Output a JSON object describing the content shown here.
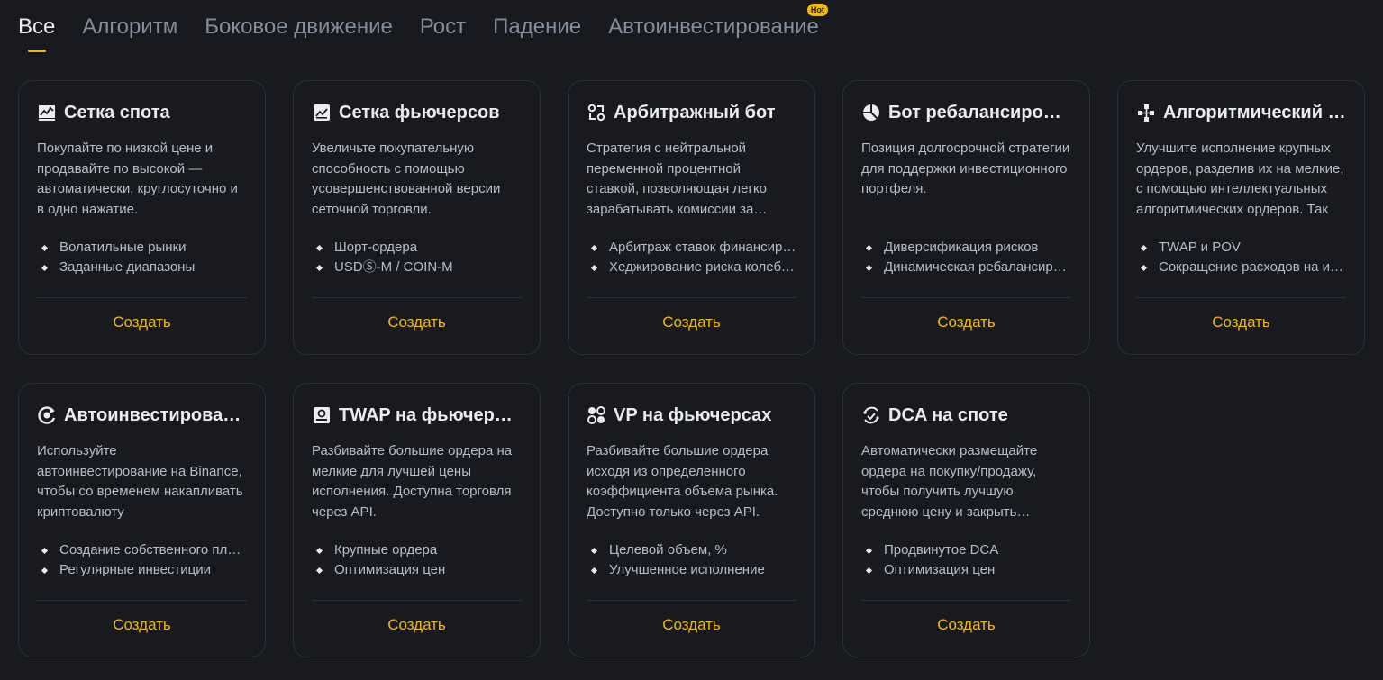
{
  "tabs": [
    {
      "label": "Все"
    },
    {
      "label": "Алгоритм"
    },
    {
      "label": "Боковое движение"
    },
    {
      "label": "Рост"
    },
    {
      "label": "Падение"
    },
    {
      "label": "Автоинвестирование",
      "badge": "Hot"
    }
  ],
  "accent_color": "#f0b90b",
  "cards": [
    {
      "icon": "spot-grid-icon",
      "title": "Сетка спота",
      "description": "Покупайте по низкой цене и продавайте по высокой — автоматически, круглосуточно и в одно нажатие.",
      "features": [
        "Волатильные рынки",
        "Заданные диапазоны"
      ],
      "button": "Создать"
    },
    {
      "icon": "futures-grid-icon",
      "title": "Сетка фьючерсов",
      "description": "Увеличьте покупательную способность с помощью усовершенствованной версии сеточной торговли.",
      "features": [
        "Шорт-ордера",
        "USDⓈ-M / COIN-M"
      ],
      "button": "Создать"
    },
    {
      "icon": "arbitrage-bot-icon",
      "title": "Арбитражный бот",
      "description": "Стратегия с нейтральной переменной процентной ставкой, позволяющая легко зарабатывать комиссии за финансирование.",
      "features": [
        "Арбитраж ставок финансирования",
        "Хеджирование риска колебаний"
      ],
      "button": "Создать"
    },
    {
      "icon": "rebalancing-bot-icon",
      "title": "Бот ребалансировки",
      "description": "Позиция долгосрочной стратегии для поддержки инвестиционного портфеля.",
      "features": [
        "Диверсификация рисков",
        "Динамическая ребалансировка"
      ],
      "button": "Создать"
    },
    {
      "icon": "algorithmic-order-icon",
      "title": "Алгоритмический ордер",
      "description": "Улучшите исполнение крупных ордеров, разделив их на мелкие, с помощью интеллектуальных алгоритмических ордеров. Так",
      "features": [
        "TWAP и POV",
        "Сокращение расходов на исполнение"
      ],
      "button": "Создать"
    },
    {
      "icon": "auto-invest-icon",
      "title": "Автоинвестирование",
      "description": "Используйте автоинвестирование на Binance, чтобы со временем накапливать криптовалюту",
      "features": [
        "Создание собственного плана",
        "Регулярные инвестиции"
      ],
      "button": "Создать"
    },
    {
      "icon": "twap-futures-icon",
      "title": "TWAP на фьючерсах",
      "description": "Разбивайте большие ордера на мелкие для лучшей цены исполнения. Доступна торговля через API.",
      "features": [
        "Крупные ордера",
        "Оптимизация цен"
      ],
      "button": "Создать"
    },
    {
      "icon": "vp-futures-icon",
      "title": "VP на фьючерсах",
      "description": "Разбивайте большие ордера исходя из определенного коэффициента объема рынка. Доступно только через API.",
      "features": [
        "Целевой объем, %",
        "Улучшенное исполнение"
      ],
      "button": "Создать"
    },
    {
      "icon": "dca-spot-icon",
      "title": "DCA на споте",
      "description": "Автоматически размещайте ордера на покупку/продажу, чтобы получить лучшую среднюю цену и закрыть позицию.",
      "features": [
        "Продвинутое DCA",
        "Оптимизация цен"
      ],
      "button": "Создать"
    }
  ]
}
